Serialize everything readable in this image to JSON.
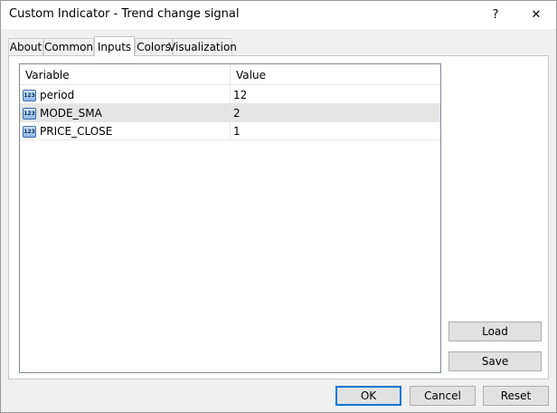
{
  "window": {
    "title": "Custom Indicator - Trend change signal",
    "help_label": "?",
    "close_label": "✕"
  },
  "tabs": [
    {
      "label": "About"
    },
    {
      "label": "Common"
    },
    {
      "label": "Inputs",
      "active": true
    },
    {
      "label": "Colors"
    },
    {
      "label": "Visualization"
    }
  ],
  "grid": {
    "headers": {
      "variable": "Variable",
      "value": "Value"
    },
    "icon_text": "123",
    "rows": [
      {
        "variable": "period",
        "value": "12"
      },
      {
        "variable": "MODE_SMA",
        "value": "2",
        "selected": true
      },
      {
        "variable": "PRICE_CLOSE",
        "value": "1"
      }
    ]
  },
  "side_buttons": {
    "load": "Load",
    "save": "Save"
  },
  "footer": {
    "ok": "OK",
    "cancel": "Cancel",
    "reset": "Reset"
  }
}
